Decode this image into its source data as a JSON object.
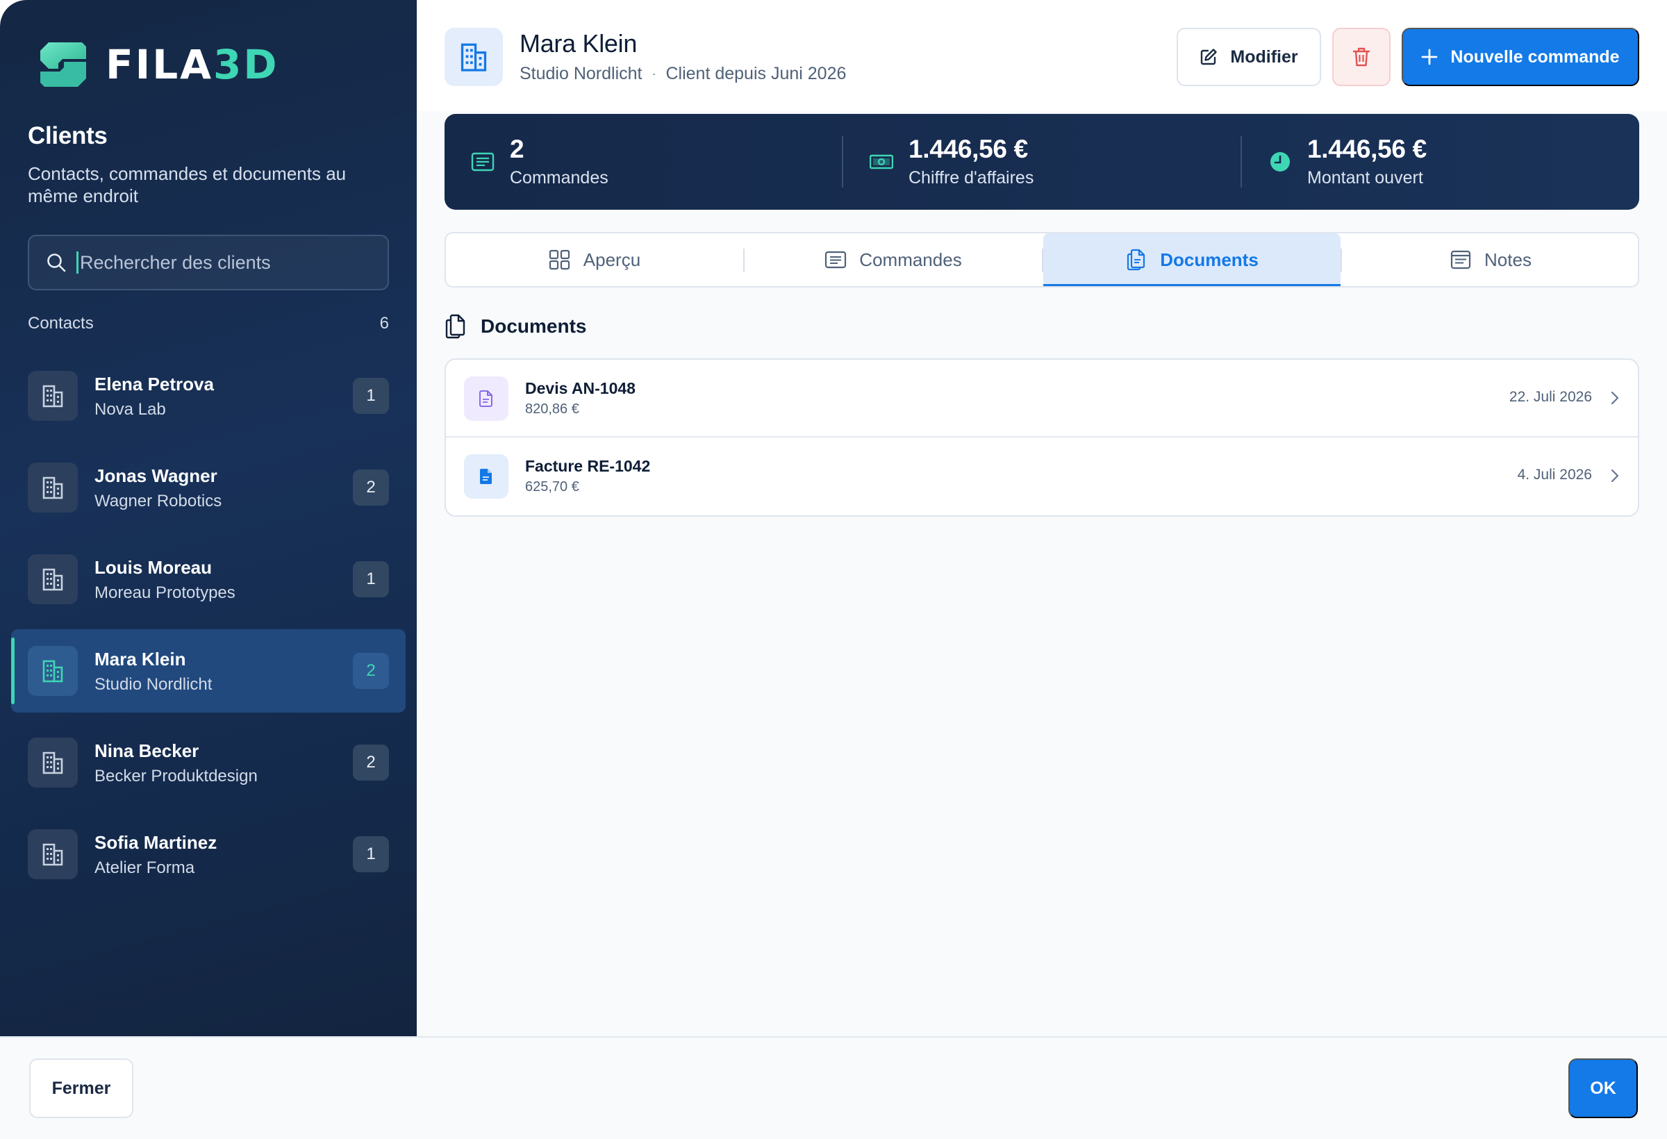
{
  "app": {
    "logo_text_main": "FILA",
    "logo_text_accent": "3D",
    "accent_color": "#3ed6b4",
    "primary_color": "#137ae8"
  },
  "sidebar": {
    "title": "Clients",
    "subtitle": "Contacts, commandes et documents au même endroit",
    "search_placeholder": "Rechercher des clients",
    "search_value": "",
    "contacts_label": "Contacts",
    "contacts_count": "6",
    "items": [
      {
        "name": "Elena Petrova",
        "company": "Nova Lab",
        "count": "1",
        "active": false
      },
      {
        "name": "Jonas Wagner",
        "company": "Wagner Robotics",
        "count": "2",
        "active": false
      },
      {
        "name": "Louis Moreau",
        "company": "Moreau Prototypes",
        "count": "1",
        "active": false
      },
      {
        "name": "Mara Klein",
        "company": "Studio Nordlicht",
        "count": "2",
        "active": true
      },
      {
        "name": "Nina Becker",
        "company": "Becker Produktdesign",
        "count": "2",
        "active": false
      },
      {
        "name": "Sofia Martinez",
        "company": "Atelier Forma",
        "count": "1",
        "active": false
      }
    ]
  },
  "header": {
    "name": "Mara Klein",
    "company": "Studio Nordlicht",
    "separator": "·",
    "since": "Client depuis Juni 2026",
    "edit_label": "Modifier",
    "new_order_label": "Nouvelle commande"
  },
  "stats": [
    {
      "value": "2",
      "label": "Commandes",
      "icon": "list-icon"
    },
    {
      "value": "1.446,56 €",
      "label": "Chiffre d'affaires",
      "icon": "banknote-icon"
    },
    {
      "value": "1.446,56 €",
      "label": "Montant ouvert",
      "icon": "clock-icon"
    }
  ],
  "tabs": [
    {
      "label": "Aperçu",
      "icon": "grid-icon",
      "active": false
    },
    {
      "label": "Commandes",
      "icon": "list-icon",
      "active": false
    },
    {
      "label": "Documents",
      "icon": "documents-icon",
      "active": true
    },
    {
      "label": "Notes",
      "icon": "notes-icon",
      "active": false
    }
  ],
  "documents": {
    "title": "Documents",
    "items": [
      {
        "title": "Devis AN-1048",
        "amount": "820,86 €",
        "date": "22. Juli 2026",
        "color": "#7c5ce6"
      },
      {
        "title": "Facture RE-1042",
        "amount": "625,70 €",
        "date": "4. Juli 2026",
        "color": "#1478e6"
      }
    ]
  },
  "footer": {
    "close_label": "Fermer",
    "ok_label": "OK"
  }
}
